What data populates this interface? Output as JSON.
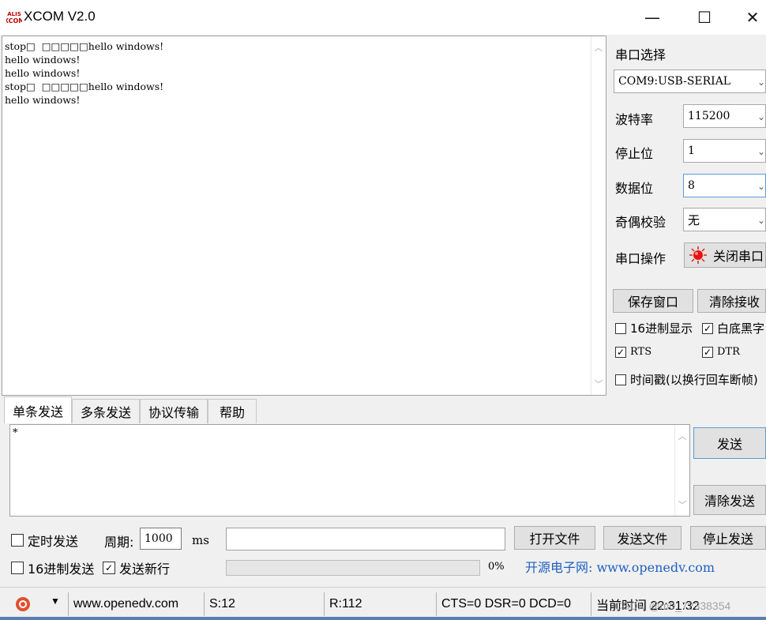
{
  "window": {
    "title": "XCOM V2.0",
    "minimize": "—",
    "maximize": "☐",
    "close": "✕"
  },
  "receive": {
    "text": "stop□  □□□□□hello windows!\nhello windows!\nhello windows!\nstop□  □□□□□hello windows!\nhello windows!"
  },
  "serial": {
    "port_label": "串口选择",
    "port_value": "COM9:USB-SERIAL",
    "baud_label": "波特率",
    "baud_value": "115200",
    "stop_label": "停止位",
    "stop_value": "1",
    "data_label": "数据位",
    "data_value": "8",
    "parity_label": "奇偶校验",
    "parity_value": "无",
    "op_label": "串口操作",
    "op_button": "关闭串口",
    "save_window": "保存窗口",
    "clear_recv": "清除接收",
    "hex_display": "16进制显示",
    "white_bg": "白底黑字",
    "rts": "RTS",
    "dtr": "DTR",
    "timestamp": "时间戳(以换行回车断帧)"
  },
  "tabs": [
    "单条发送",
    "多条发送",
    "协议传输",
    "帮助"
  ],
  "send": {
    "text": "*",
    "send_button": "发送",
    "clear_send": "清除发送",
    "timed_send": "定时发送",
    "period_label": "周期:",
    "period_value": "1000",
    "period_unit": "ms",
    "hex_send": "16进制发送",
    "newline": "发送新行",
    "open_file": "打开文件",
    "send_file": "发送文件",
    "stop_send": "停止发送",
    "progress_text": "0%",
    "progress": 0,
    "promo": "开源电子网: www.openedv.com"
  },
  "status": {
    "url": "www.openedv.com",
    "sent": "S:12",
    "received": "R:112",
    "lines": "CTS=0 DSR=0 DCD=0",
    "time": "当前时间 22:31:32",
    "watermark": "CSDN @m0_72338354"
  },
  "colors": {
    "promo": "#2060c0",
    "accent": "#5b7fb0"
  }
}
